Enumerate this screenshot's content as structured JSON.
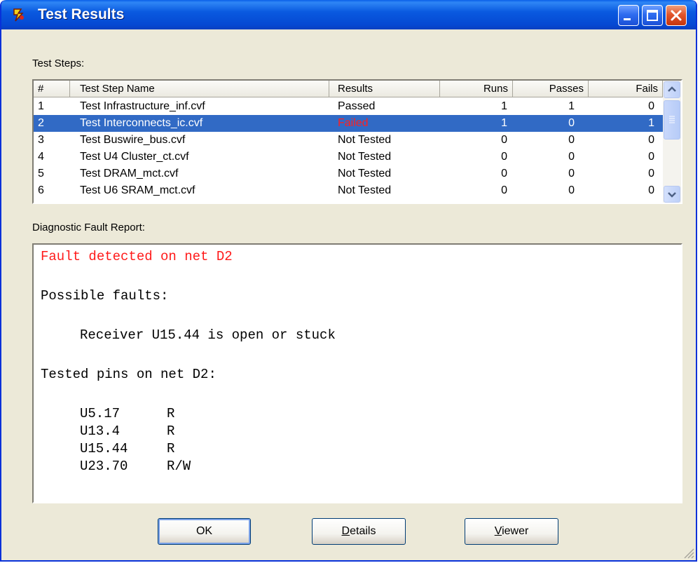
{
  "window": {
    "title": "Test Results",
    "icon": "app-icon"
  },
  "test_steps": {
    "label": "Test Steps:",
    "columns": [
      "#",
      "Test Step Name",
      "Results",
      "Runs",
      "Passes",
      "Fails"
    ],
    "rows": [
      {
        "num": "1",
        "name": "Test Infrastructure_inf.cvf",
        "result": "Passed",
        "runs": "1",
        "passes": "1",
        "fails": "0"
      },
      {
        "num": "2",
        "name": "Test Interconnects_ic.cvf",
        "result": "Failed",
        "runs": "1",
        "passes": "0",
        "fails": "1"
      },
      {
        "num": "3",
        "name": "Test Buswire_bus.cvf",
        "result": "Not Tested",
        "runs": "0",
        "passes": "0",
        "fails": "0"
      },
      {
        "num": "4",
        "name": "Test U4 Cluster_ct.cvf",
        "result": "Not Tested",
        "runs": "0",
        "passes": "0",
        "fails": "0"
      },
      {
        "num": "5",
        "name": "Test DRAM_mct.cvf",
        "result": "Not Tested",
        "runs": "0",
        "passes": "0",
        "fails": "0"
      },
      {
        "num": "6",
        "name": "Test U6 SRAM_mct.cvf",
        "result": "Not Tested",
        "runs": "0",
        "passes": "0",
        "fails": "0"
      }
    ],
    "selected_index": 1,
    "fail_color": "#ff2020",
    "selection_color": "#316ac5"
  },
  "report": {
    "label": "Diagnostic Fault Report:",
    "fault_line": "Fault detected on net D2",
    "possible_faults_heading": "Possible faults:",
    "possible_fault": "Receiver U15.44 is open or stuck",
    "tested_pins_heading": "Tested pins on net D2:",
    "pins": [
      {
        "pin": "U5.17",
        "dir": "R"
      },
      {
        "pin": "U13.4",
        "dir": "R"
      },
      {
        "pin": "U15.44",
        "dir": "R"
      },
      {
        "pin": "U23.70",
        "dir": "R/W"
      }
    ]
  },
  "buttons": {
    "ok": "OK",
    "details_mnemonic": "D",
    "details_rest": "etails",
    "viewer_mnemonic": "V",
    "viewer_rest": "iewer"
  }
}
